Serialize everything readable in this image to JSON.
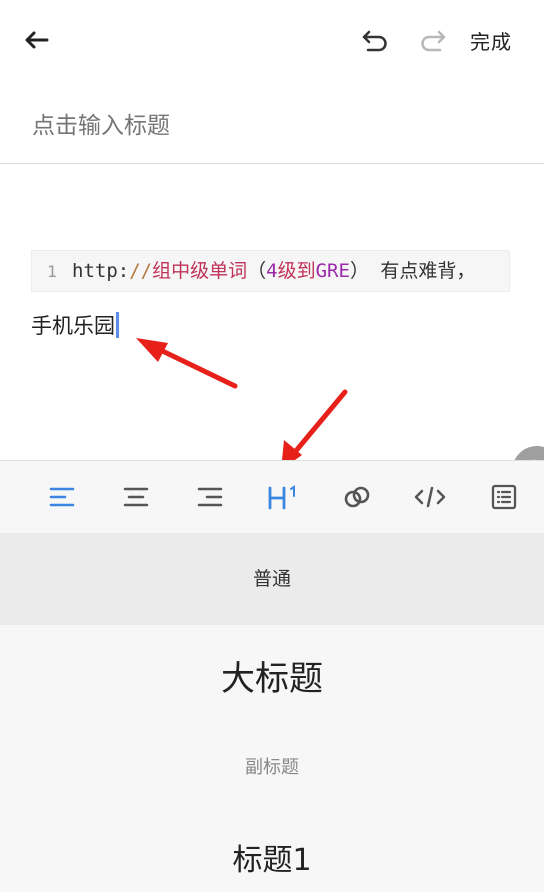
{
  "header": {
    "done_label": "完成",
    "icons": [
      "back-arrow-icon",
      "undo-icon",
      "redo-icon"
    ]
  },
  "editor": {
    "title_placeholder": "点击输入标题",
    "code_block": {
      "line_number": "1",
      "tokens": {
        "scheme": "http",
        "colon": ":",
        "slashes": "//",
        "text_a": "组中级单词",
        "paren_open": "（",
        "num": "4",
        "text_b": "级到",
        "gre": "GRE",
        "paren_close": "）",
        "rest": " 有点难背，"
      }
    },
    "paragraph": "手机乐园"
  },
  "toolbar": {
    "items": [
      "align-left-icon",
      "align-center-icon",
      "align-right-icon",
      "heading-icon",
      "link-icon",
      "code-icon",
      "list-icon"
    ],
    "active_color": "#3a86e0",
    "icon_color": "#555555"
  },
  "heading_menu": {
    "normal": "普通",
    "big_title": "大标题",
    "subtitle": "副标题",
    "heading1": "标题1"
  },
  "annotation_color": "#e8201a"
}
